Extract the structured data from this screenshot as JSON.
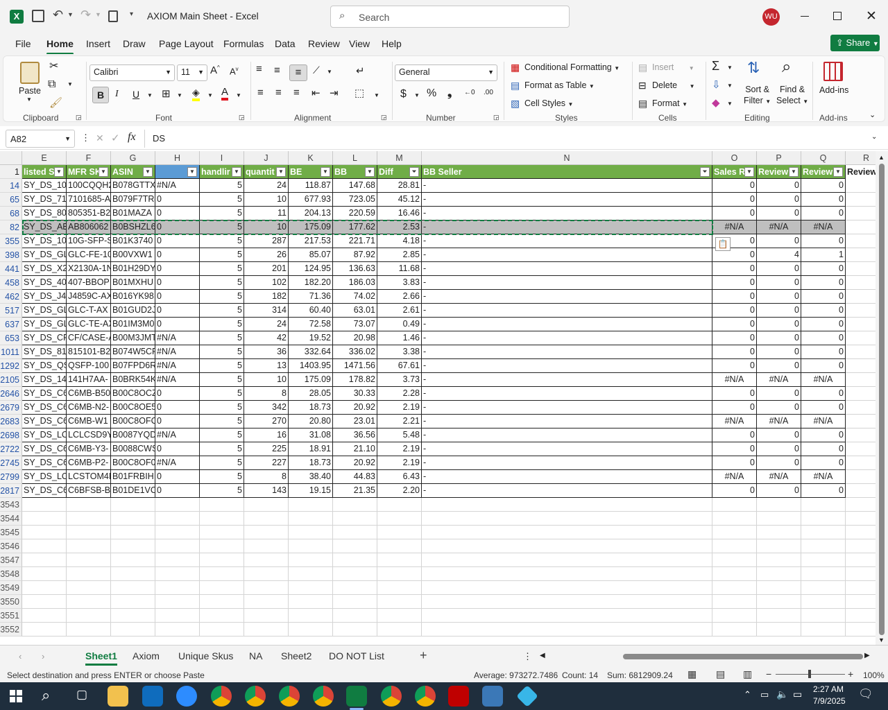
{
  "title": {
    "doc": "AXIOM Main Sheet",
    "app": "Excel",
    "search_placeholder": "Search",
    "user_initials": "WU"
  },
  "menus": [
    "File",
    "Home",
    "Insert",
    "Draw",
    "Page Layout",
    "Formulas",
    "Data",
    "Review",
    "View",
    "Help"
  ],
  "share_label": "Share",
  "ribbon": {
    "paste": "Paste",
    "clipboard": "Clipboard",
    "font_name": "Calibri",
    "font_size": "11",
    "font": "Font",
    "alignment": "Alignment",
    "number_format": "General",
    "number": "Number",
    "cond_format": "Conditional Formatting",
    "format_table": "Format as Table",
    "cell_styles": "Cell Styles",
    "styles": "Styles",
    "insert": "Insert",
    "delete": "Delete",
    "format": "Format",
    "cells": "Cells",
    "sort_filter_1": "Sort &",
    "sort_filter_2": "Filter",
    "find_select_1": "Find &",
    "find_select_2": "Select",
    "editing": "Editing",
    "addins": "Add-ins",
    "addins_group": "Add-ins",
    "bold": "B",
    "italic": "I",
    "underline": "U"
  },
  "formula_bar": {
    "name_box": "A82",
    "fx": "fx",
    "content": "DS"
  },
  "columns": [
    "E",
    "F",
    "G",
    "H",
    "I",
    "J",
    "K",
    "L",
    "M",
    "N",
    "O",
    "P",
    "Q",
    "R"
  ],
  "headers": [
    "listed S",
    "MFR SK",
    "ASIN",
    "",
    "handlir",
    "quantit",
    "BE",
    "BB",
    "Diff",
    "BB Seller",
    "Sales R",
    "Review",
    "Review",
    "Review"
  ],
  "rows": [
    {
      "n": "14",
      "e": "SY_DS_100",
      "f": "100CQQH2",
      "g": "B078GTTX",
      "h": "#N/A",
      "i": "5",
      "j": "24",
      "k": "118.87",
      "l": "147.68",
      "m": "28.81",
      "nn": "-",
      "o": "0",
      "p": "0",
      "q": "0"
    },
    {
      "n": "65",
      "e": "SY_DS_710",
      "f": "7101685-A",
      "g": "B079F7TR4",
      "h": "0",
      "i": "5",
      "j": "10",
      "k": "677.93",
      "l": "723.05",
      "m": "45.12",
      "nn": "-",
      "o": "0",
      "p": "0",
      "q": "0"
    },
    {
      "n": "68",
      "e": "SY_DS_805",
      "f": "805351-B2",
      "g": "B01MAZA",
      "h": "0",
      "i": "5",
      "j": "11",
      "k": "204.13",
      "l": "220.59",
      "m": "16.46",
      "nn": "-",
      "o": "0",
      "p": "0",
      "q": "0"
    },
    {
      "n": "82",
      "e": "SY_DS_AB",
      "f": "AB806062",
      "g": "B0BSHZL6",
      "h": "0",
      "i": "5",
      "j": "10",
      "k": "175.09",
      "l": "177.62",
      "m": "2.53",
      "nn": "-",
      "o": "#N/A",
      "p": "#N/A",
      "q": "#N/A"
    },
    {
      "n": "355",
      "e": "SY_DS_10G",
      "f": "10G-SFP-S",
      "g": "B01K3740",
      "h": "0",
      "i": "5",
      "j": "287",
      "k": "217.53",
      "l": "221.71",
      "m": "4.18",
      "nn": "-",
      "o": "0",
      "p": "0",
      "q": "0"
    },
    {
      "n": "398",
      "e": "SY_DS_GL",
      "f": "GLC-FE-10",
      "g": "B00VXW1",
      "h": "0",
      "i": "5",
      "j": "26",
      "k": "85.07",
      "l": "87.92",
      "m": "2.85",
      "nn": "-",
      "o": "0",
      "p": "4",
      "q": "1"
    },
    {
      "n": "441",
      "e": "SY_DS_X2",
      "f": "X2130A-1N",
      "g": "B01H29DY",
      "h": "0",
      "i": "5",
      "j": "201",
      "k": "124.95",
      "l": "136.63",
      "m": "11.68",
      "nn": "-",
      "o": "0",
      "p": "0",
      "q": "0"
    },
    {
      "n": "458",
      "e": "SY_DS_407",
      "f": "407-BBOP",
      "g": "B01MXHU",
      "h": "0",
      "i": "5",
      "j": "102",
      "k": "182.20",
      "l": "186.03",
      "m": "3.83",
      "nn": "-",
      "o": "0",
      "p": "0",
      "q": "0"
    },
    {
      "n": "462",
      "e": "SY_DS_J48",
      "f": "J4859C-AX",
      "g": "B016YK98",
      "h": "0",
      "i": "5",
      "j": "182",
      "k": "71.36",
      "l": "74.02",
      "m": "2.66",
      "nn": "-",
      "o": "0",
      "p": "0",
      "q": "0"
    },
    {
      "n": "517",
      "e": "SY_DS_GL",
      "f": "GLC-T-AX",
      "g": "B01GUD2J",
      "h": "0",
      "i": "5",
      "j": "314",
      "k": "60.40",
      "l": "63.01",
      "m": "2.61",
      "nn": "-",
      "o": "0",
      "p": "0",
      "q": "0"
    },
    {
      "n": "637",
      "e": "SY_DS_GL",
      "f": "GLC-TE-AX",
      "g": "B01IM3M0",
      "h": "0",
      "i": "5",
      "j": "24",
      "k": "72.58",
      "l": "73.07",
      "m": "0.49",
      "nn": "-",
      "o": "0",
      "p": "0",
      "q": "0"
    },
    {
      "n": "653",
      "e": "SY_DS_CF",
      "f": "CF/CASE-A",
      "g": "B00M3JMT",
      "h": "#N/A",
      "i": "5",
      "j": "42",
      "k": "19.52",
      "l": "20.98",
      "m": "1.46",
      "nn": "-",
      "o": "0",
      "p": "0",
      "q": "0"
    },
    {
      "n": "1011",
      "e": "SY_DS_815",
      "f": "815101-B2",
      "g": "B074W5CF",
      "h": "#N/A",
      "i": "5",
      "j": "36",
      "k": "332.64",
      "l": "336.02",
      "m": "3.38",
      "nn": "-",
      "o": "0",
      "p": "0",
      "q": "0"
    },
    {
      "n": "1292",
      "e": "SY_DS_QS",
      "f": "QSFP-100",
      "g": "B07FPD6R",
      "h": "#N/A",
      "i": "5",
      "j": "13",
      "k": "1403.95",
      "l": "1471.56",
      "m": "67.61",
      "nn": "-",
      "o": "0",
      "p": "0",
      "q": "0"
    },
    {
      "n": "2105",
      "e": "SY_DS_141",
      "f": "141H7AA-",
      "g": "B0BRK54K",
      "h": "#N/A",
      "i": "5",
      "j": "10",
      "k": "175.09",
      "l": "178.82",
      "m": "3.73",
      "nn": "-",
      "o": "#N/A",
      "p": "#N/A",
      "q": "#N/A"
    },
    {
      "n": "2646",
      "e": "SY_DS_C6",
      "f": "C6MB-B50",
      "g": "B00C8OCZ",
      "h": "0",
      "i": "5",
      "j": "8",
      "k": "28.05",
      "l": "30.33",
      "m": "2.28",
      "nn": "-",
      "o": "0",
      "p": "0",
      "q": "0"
    },
    {
      "n": "2679",
      "e": "SY_DS_C6",
      "f": "C6MB-N2-",
      "g": "B00C8OE5",
      "h": "0",
      "i": "5",
      "j": "342",
      "k": "18.73",
      "l": "20.92",
      "m": "2.19",
      "nn": "-",
      "o": "0",
      "p": "0",
      "q": "0"
    },
    {
      "n": "2683",
      "e": "SY_DS_C6",
      "f": "C6MB-W1",
      "g": "B00C8OFC",
      "h": "0",
      "i": "5",
      "j": "270",
      "k": "20.80",
      "l": "23.01",
      "m": "2.21",
      "nn": "-",
      "o": "#N/A",
      "p": "#N/A",
      "q": "#N/A"
    },
    {
      "n": "2698",
      "e": "SY_DS_LCL",
      "f": "LCLCSD9Y-",
      "g": "B0087YQD",
      "h": "#N/A",
      "i": "5",
      "j": "16",
      "k": "31.08",
      "l": "36.56",
      "m": "5.48",
      "nn": "-",
      "o": "0",
      "p": "0",
      "q": "0"
    },
    {
      "n": "2722",
      "e": "SY_DS_C6",
      "f": "C6MB-Y3-",
      "g": "B0088CWS",
      "h": "0",
      "i": "5",
      "j": "225",
      "k": "18.91",
      "l": "21.10",
      "m": "2.19",
      "nn": "-",
      "o": "0",
      "p": "0",
      "q": "0"
    },
    {
      "n": "2745",
      "e": "SY_DS_C6",
      "f": "C6MB-P2-",
      "g": "B00C8OF0",
      "h": "#N/A",
      "i": "5",
      "j": "227",
      "k": "18.73",
      "l": "20.92",
      "m": "2.19",
      "nn": "-",
      "o": "0",
      "p": "0",
      "q": "0"
    },
    {
      "n": "2799",
      "e": "SY_DS_LCS",
      "f": "LCSTOM4N",
      "g": "B01FRBIH",
      "h": "0",
      "i": "5",
      "j": "8",
      "k": "38.40",
      "l": "44.83",
      "m": "6.43",
      "nn": "-",
      "o": "#N/A",
      "p": "#N/A",
      "q": "#N/A"
    },
    {
      "n": "2817",
      "e": "SY_DS_C6",
      "f": "C6BFSB-B3",
      "g": "B01DE1VC",
      "h": "0",
      "i": "5",
      "j": "143",
      "k": "19.15",
      "l": "21.35",
      "m": "2.20",
      "nn": "-",
      "o": "0",
      "p": "0",
      "q": "0"
    }
  ],
  "empty_rows": [
    "3543",
    "3544",
    "3545",
    "3546",
    "3547",
    "3548",
    "3549",
    "3550",
    "3551",
    "3552"
  ],
  "sheets": [
    "Sheet1",
    "Axiom",
    "Unique Skus",
    "NA",
    "Sheet2",
    "DO NOT List"
  ],
  "status": {
    "message": "Select destination and press ENTER or choose Paste",
    "average": "Average: 973272.7486",
    "count": "Count: 14",
    "sum": "Sum: 6812909.24",
    "zoom": "100%"
  },
  "taskbar": {
    "time": "2:27 AM",
    "date": "7/9/2025"
  }
}
